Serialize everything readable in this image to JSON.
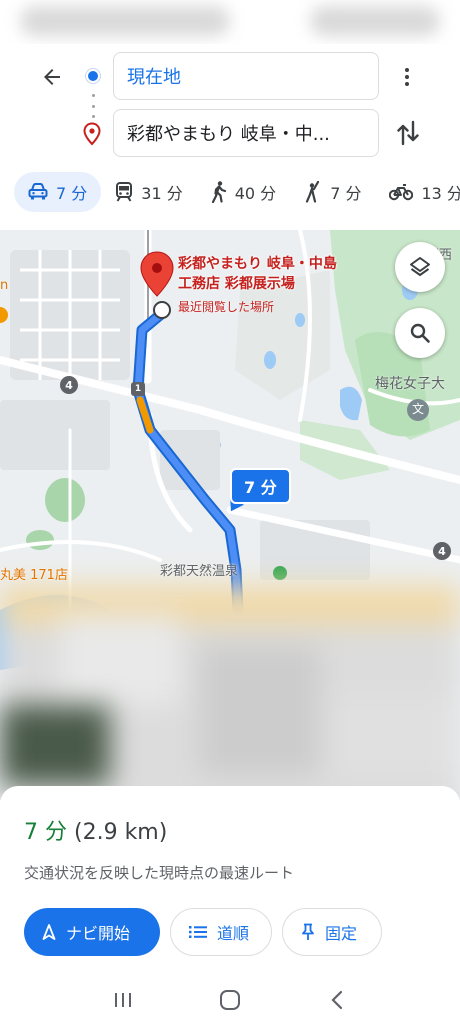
{
  "search": {
    "origin_value": "現在地",
    "destination_value": "彩都やまもり 岐阜・中..."
  },
  "modes": [
    {
      "name": "drive",
      "label": "7 分",
      "icon": "car-icon",
      "active": true
    },
    {
      "name": "transit",
      "label": "31 分",
      "icon": "train-icon",
      "active": false
    },
    {
      "name": "walk",
      "label": "40 分",
      "icon": "walk-icon",
      "active": false
    },
    {
      "name": "ride",
      "label": "7 分",
      "icon": "person-hail-icon",
      "active": false
    },
    {
      "name": "bike",
      "label": "13 分",
      "icon": "bike-icon",
      "active": false
    }
  ],
  "map": {
    "destination_label": "彩都やまもり 岐阜・中島\n工務店 彩都展示場",
    "destination_sublabel": "最近閲覧した場所",
    "route_time_bubble": "7 分",
    "place_labels": {
      "university": "梅花女子大",
      "north_east": "関西",
      "store": "丸美 171店",
      "onsen": "彩都天然温泉",
      "west_edge": "n"
    },
    "road_numbers": {
      "route_4_left": "4",
      "route_4_right": "4",
      "route_1": "1"
    },
    "school_marker": "文"
  },
  "sheet": {
    "eta_time": "7 分",
    "eta_distance": "(2.9 km)",
    "route_description": "交通状況を反映した現時点の最速ルート",
    "start_nav_label": "ナビ開始",
    "steps_label": "道順",
    "pin_label": "固定"
  },
  "colors": {
    "accent": "#1a73e8",
    "eta_green": "#188038",
    "destination_red": "#c5221f",
    "traffic_orange": "#f29900"
  }
}
